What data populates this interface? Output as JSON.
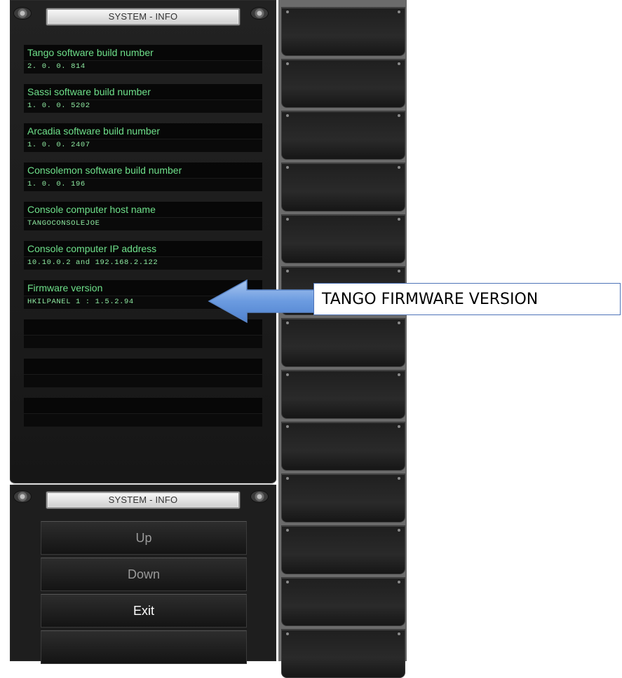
{
  "header_top": {
    "title": "SYSTEM - INFO"
  },
  "info_items": [
    {
      "label": "Tango software build number",
      "value": "2. 0. 0. 814"
    },
    {
      "label": "Sassi software build number",
      "value": "1. 0. 0. 5202"
    },
    {
      "label": "Arcadia software build number",
      "value": "1. 0. 0. 2407"
    },
    {
      "label": "Consolemon software build number",
      "value": "1. 0. 0. 196"
    },
    {
      "label": "Console computer host name",
      "value": "TANGOCONSOLEJOE"
    },
    {
      "label": "Console computer IP address",
      "value": "10.10.0.2 and 192.168.2.122"
    },
    {
      "label": "Firmware version",
      "value": "HKILPANEL 1 : 1.5.2.94"
    }
  ],
  "header_bottom": {
    "title": "SYSTEM - INFO"
  },
  "buttons": {
    "up": "Up",
    "down": "Down",
    "exit": "Exit",
    "blank": ""
  },
  "callout": {
    "text": "TANGO FIRMWARE VERSION",
    "arrow_color": "#6b9be0"
  }
}
